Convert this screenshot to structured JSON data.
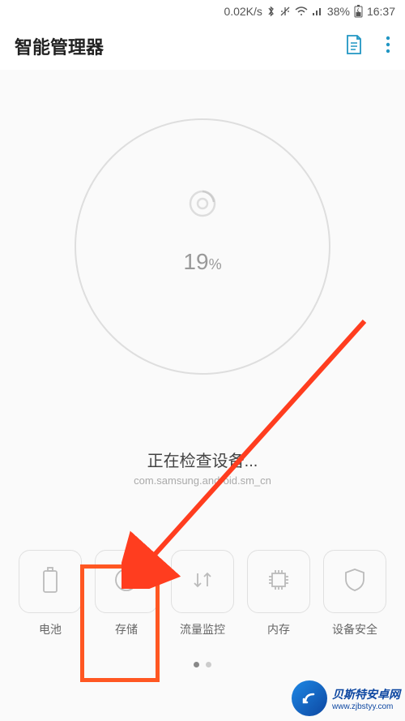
{
  "status_bar": {
    "speed": "0.02K/s",
    "battery_pct": "38%",
    "time": "16:37"
  },
  "header": {
    "title": "智能管理器"
  },
  "gauge": {
    "percent_value": "19",
    "percent_unit": "%"
  },
  "status": {
    "checking_label": "正在检查设备...",
    "package": "com.samsung.android.sm_cn"
  },
  "tiles": [
    {
      "label": "电池"
    },
    {
      "label": "存储"
    },
    {
      "label": "流量监控"
    },
    {
      "label": "内存"
    },
    {
      "label": "设备安全"
    }
  ],
  "watermark": {
    "line1": "贝斯特安卓网",
    "line2": "www.zjbstyy.com"
  }
}
